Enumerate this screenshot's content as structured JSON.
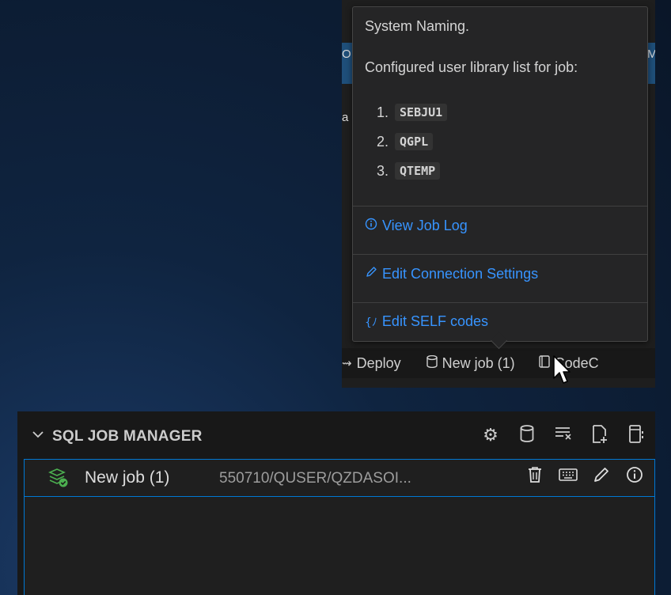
{
  "editor": {
    "left_char_1": "O",
    "left_char_2": "a",
    "right_char": "M"
  },
  "hover": {
    "naming": "System Naming.",
    "library_heading": "Configured user library list for job:",
    "libraries": [
      {
        "num": "1.",
        "name": "SEBJU1"
      },
      {
        "num": "2.",
        "name": "QGPL"
      },
      {
        "num": "3.",
        "name": "QTEMP"
      }
    ],
    "view_log": {
      "icon": "info-icon",
      "label": "View Job Log"
    },
    "edit_settings": {
      "icon": "pencil-icon",
      "label": "Edit Connection Settings"
    },
    "edit_self": {
      "icon": "bracket-gear-icon",
      "label": "Edit SELF codes"
    }
  },
  "status_bar": {
    "deploy": "Deploy",
    "new_job": "New job (1)",
    "code": "CodeC"
  },
  "panel": {
    "title": "SQL JOB MANAGER",
    "header_icons": [
      "settings-icon",
      "database-icon",
      "clear-all-icon",
      "new-file-icon",
      "notebook-icon"
    ],
    "job": {
      "name": "New job (1)",
      "description": "550710/QUSER/QZDASOI...",
      "row_icons": [
        "trash-icon",
        "keyboard-icon",
        "pencil-icon",
        "info-icon"
      ]
    }
  },
  "colors": {
    "link": "#3794ff",
    "selection_border": "#0078d4",
    "job_icon": "#4caf50"
  }
}
